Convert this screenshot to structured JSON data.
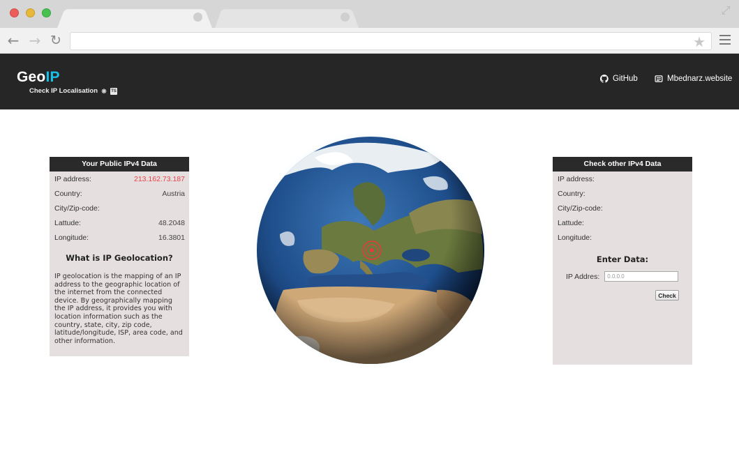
{
  "site": {
    "logo_main": "Geo",
    "logo_accent": "IP",
    "subtitle": "Check IP Localisation",
    "nav": [
      {
        "label": "GitHub",
        "icon": "github-icon"
      },
      {
        "label": "Mbednarz.website",
        "icon": "website-icon"
      }
    ]
  },
  "public_panel": {
    "title": "Your Public IPv4 Data",
    "rows": [
      {
        "label": "IP address:",
        "value": "213.162.73.187"
      },
      {
        "label": "Country:",
        "value": "Austria"
      },
      {
        "label": "City/Zip-code:",
        "value": ""
      },
      {
        "label": "Lattude:",
        "value": "48.2048"
      },
      {
        "label": "Longitude:",
        "value": "16.3801"
      }
    ],
    "info_title": "What is IP Geolocation?",
    "info_text": "IP geolocation is the mapping of an IP address to the geographic location of the internet from the connected device. By geographically mapping the IP address, it provides you with location information such as the country, state, city, zip code, latitude/longitude, ISP, area code, and other information."
  },
  "check_panel": {
    "title": "Check other IPv4 Data",
    "rows": [
      {
        "label": "IP address:",
        "value": ""
      },
      {
        "label": "Country:",
        "value": ""
      },
      {
        "label": "City/Zip-code:",
        "value": ""
      },
      {
        "label": "Lattude:",
        "value": ""
      },
      {
        "label": "Longitude:",
        "value": ""
      }
    ],
    "enter_title": "Enter Data:",
    "input_label": "IP Addres:",
    "input_placeholder": "0.0.0.0",
    "button_label": "Check"
  },
  "colors": {
    "header_bg": "#262626",
    "accent": "#19c0e8",
    "ip_value": "#e8434a",
    "panel_bg": "#e6dfdf"
  }
}
